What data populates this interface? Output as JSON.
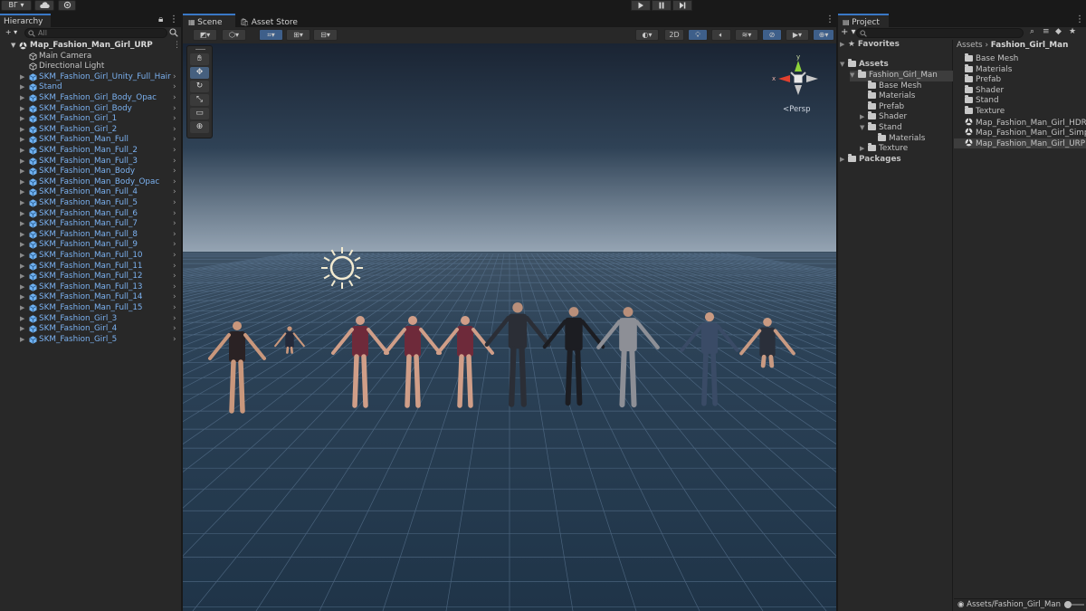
{
  "topbar": {
    "account_label": "BГ ▾",
    "play_icon": "play-icon",
    "pause_icon": "pause-icon",
    "step_icon": "step-icon"
  },
  "hierarchy": {
    "tab_label": "Hierarchy",
    "search_placeholder": "All",
    "scene_name": "Map_Fashion_Man_Girl_URP",
    "items": [
      {
        "label": "Main Camera",
        "prefab": false
      },
      {
        "label": "Directional Light",
        "prefab": false
      },
      {
        "label": "SKM_Fashion_Girl_Unity_Full_Hair",
        "prefab": true
      },
      {
        "label": "Stand",
        "prefab": true
      },
      {
        "label": "SKM_Fashion_Girl_Body_Opac",
        "prefab": true
      },
      {
        "label": "SKM_Fashion_Girl_Body",
        "prefab": true
      },
      {
        "label": "SKM_Fashion_Girl_1",
        "prefab": true
      },
      {
        "label": "SKM_Fashion_Girl_2",
        "prefab": true
      },
      {
        "label": "SKM_Fashion_Man_Full",
        "prefab": true
      },
      {
        "label": "SKM_Fashion_Man_Full_2",
        "prefab": true
      },
      {
        "label": "SKM_Fashion_Man_Full_3",
        "prefab": true
      },
      {
        "label": "SKM_Fashion_Man_Body",
        "prefab": true
      },
      {
        "label": "SKM_Fashion_Man_Body_Opac",
        "prefab": true
      },
      {
        "label": "SKM_Fashion_Man_Full_4",
        "prefab": true
      },
      {
        "label": "SKM_Fashion_Man_Full_5",
        "prefab": true
      },
      {
        "label": "SKM_Fashion_Man_Full_6",
        "prefab": true
      },
      {
        "label": "SKM_Fashion_Man_Full_7",
        "prefab": true
      },
      {
        "label": "SKM_Fashion_Man_Full_8",
        "prefab": true
      },
      {
        "label": "SKM_Fashion_Man_Full_9",
        "prefab": true
      },
      {
        "label": "SKM_Fashion_Man_Full_10",
        "prefab": true
      },
      {
        "label": "SKM_Fashion_Man_Full_11",
        "prefab": true
      },
      {
        "label": "SKM_Fashion_Man_Full_12",
        "prefab": true
      },
      {
        "label": "SKM_Fashion_Man_Full_13",
        "prefab": true
      },
      {
        "label": "SKM_Fashion_Man_Full_14",
        "prefab": true
      },
      {
        "label": "SKM_Fashion_Man_Full_15",
        "prefab": true
      },
      {
        "label": "SKM_Fashion_Girl_3",
        "prefab": true
      },
      {
        "label": "SKM_Fashion_Girl_4",
        "prefab": true
      },
      {
        "label": "SKM_Fashion_Girl_5",
        "prefab": true
      }
    ]
  },
  "scene": {
    "tab_scene": "Scene",
    "tab_asset_store": "Asset Store",
    "toggle_2d": "2D",
    "persp_label": "<Persp",
    "gizmo_x": "x",
    "gizmo_y": "y"
  },
  "project": {
    "tab_label": "Project",
    "add_label": "+ ▾",
    "favorites": "Favorites",
    "assets": "Assets",
    "packages": "Packages",
    "tree": [
      {
        "label": "Fashion_Girl_Man",
        "level": 1,
        "arrow": "▼",
        "selected": true
      },
      {
        "label": "Base Mesh",
        "level": 2,
        "arrow": "",
        "selected": false
      },
      {
        "label": "Materials",
        "level": 2,
        "arrow": "",
        "selected": false
      },
      {
        "label": "Prefab",
        "level": 2,
        "arrow": "",
        "selected": false
      },
      {
        "label": "Shader",
        "level": 2,
        "arrow": "▶",
        "selected": false
      },
      {
        "label": "Stand",
        "level": 2,
        "arrow": "▼",
        "selected": false
      },
      {
        "label": "Materials",
        "level": 3,
        "arrow": "",
        "selected": false
      },
      {
        "label": "Texture",
        "level": 2,
        "arrow": "▶",
        "selected": false
      }
    ],
    "breadcrumb_root": "Assets",
    "breadcrumb_sep": "›",
    "breadcrumb_current": "Fashion_Girl_Man",
    "list": [
      {
        "label": "Base Mesh",
        "type": "folder"
      },
      {
        "label": "Materials",
        "type": "folder"
      },
      {
        "label": "Prefab",
        "type": "folder"
      },
      {
        "label": "Shader",
        "type": "folder"
      },
      {
        "label": "Stand",
        "type": "folder"
      },
      {
        "label": "Texture",
        "type": "folder"
      },
      {
        "label": "Map_Fashion_Man_Girl_HDRP",
        "type": "scene"
      },
      {
        "label": "Map_Fashion_Man_Girl_Simpl",
        "type": "scene"
      },
      {
        "label": "Map_Fashion_Man_Girl_URP",
        "type": "scene"
      }
    ],
    "footer_path": "Assets/Fashion_Girl_Man"
  },
  "colors": {
    "prefab_blue": "#7bb1f0",
    "accent_blue": "#3a78c6",
    "panel_bg": "#282828",
    "sky_top": "#1a2433",
    "horizon": "#8f9fae",
    "ground": "#263a4f"
  }
}
